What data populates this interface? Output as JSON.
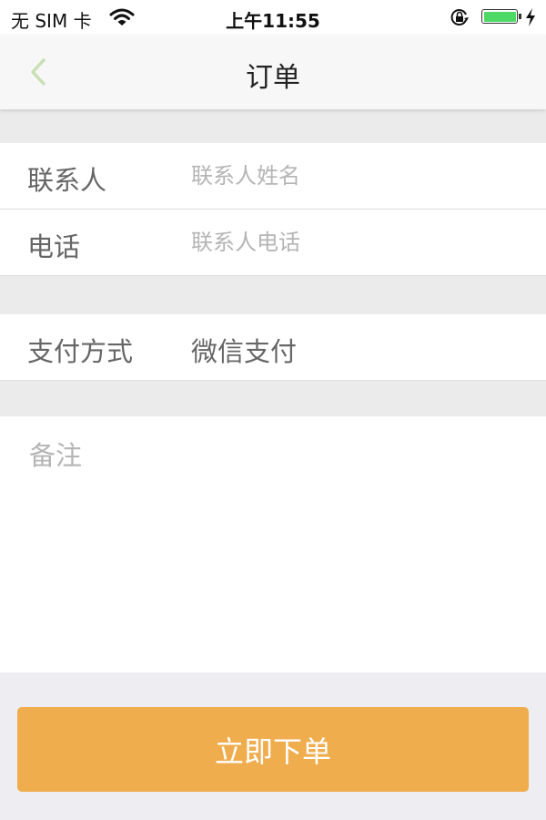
{
  "status_bar": {
    "carrier": "无 SIM 卡",
    "time": "上午11:55",
    "battery_level_percent": 100,
    "icons": [
      "wifi-icon",
      "rotation-lock-icon",
      "battery-icon",
      "charging-bolt-icon"
    ]
  },
  "nav": {
    "back_icon": "chevron-left-icon",
    "title": "订单"
  },
  "form": {
    "contact": {
      "label": "联系人",
      "value": "",
      "placeholder": "联系人姓名"
    },
    "phone": {
      "label": "电话",
      "value": "",
      "placeholder": "联系人电话"
    },
    "payment": {
      "label": "支付方式",
      "value": "微信支付"
    },
    "remark": {
      "value": "",
      "placeholder": "备注"
    }
  },
  "actions": {
    "submit_label": "立即下单"
  },
  "colors": {
    "accent": "#efad4e",
    "back_icon": "#c8e0b4",
    "battery": "#4cd964",
    "background": "#ebebeb"
  }
}
